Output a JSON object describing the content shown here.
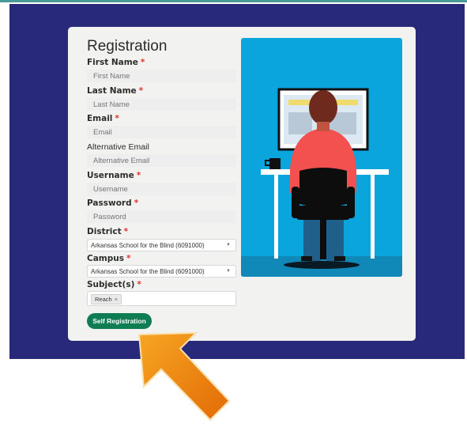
{
  "form": {
    "title": "Registration",
    "required_mark": "*",
    "fields": {
      "first_name": {
        "label": "First Name",
        "placeholder": "First Name",
        "value": ""
      },
      "last_name": {
        "label": "Last Name",
        "placeholder": "Last Name",
        "value": ""
      },
      "email": {
        "label": "Email",
        "placeholder": "Email",
        "value": ""
      },
      "alt_email": {
        "label": "Alternative Email",
        "placeholder": "Alternative Email",
        "value": ""
      },
      "username": {
        "label": "Username",
        "placeholder": "Username",
        "value": ""
      },
      "password": {
        "label": "Password",
        "placeholder": "Password",
        "value": ""
      }
    },
    "district": {
      "label": "District",
      "selected": "Arkansas School for the Blind (6091000)"
    },
    "campus": {
      "label": "Campus",
      "selected": "Arkansas School for the Blind (6091000)"
    },
    "subjects": {
      "label": "Subject(s)",
      "tags": [
        "Reach"
      ],
      "remove_glyph": "×"
    },
    "submit_label": "Self Registration"
  },
  "colors": {
    "band": "#29297a",
    "card": "#f2f2f1",
    "button": "#0f7d54",
    "required": "#e0362b",
    "illustration_bg": "#0aa5dd",
    "arrow": "#f08a0c"
  },
  "icons": {
    "caret": "chevron-down-icon",
    "arrow": "pointing-arrow-icon"
  }
}
